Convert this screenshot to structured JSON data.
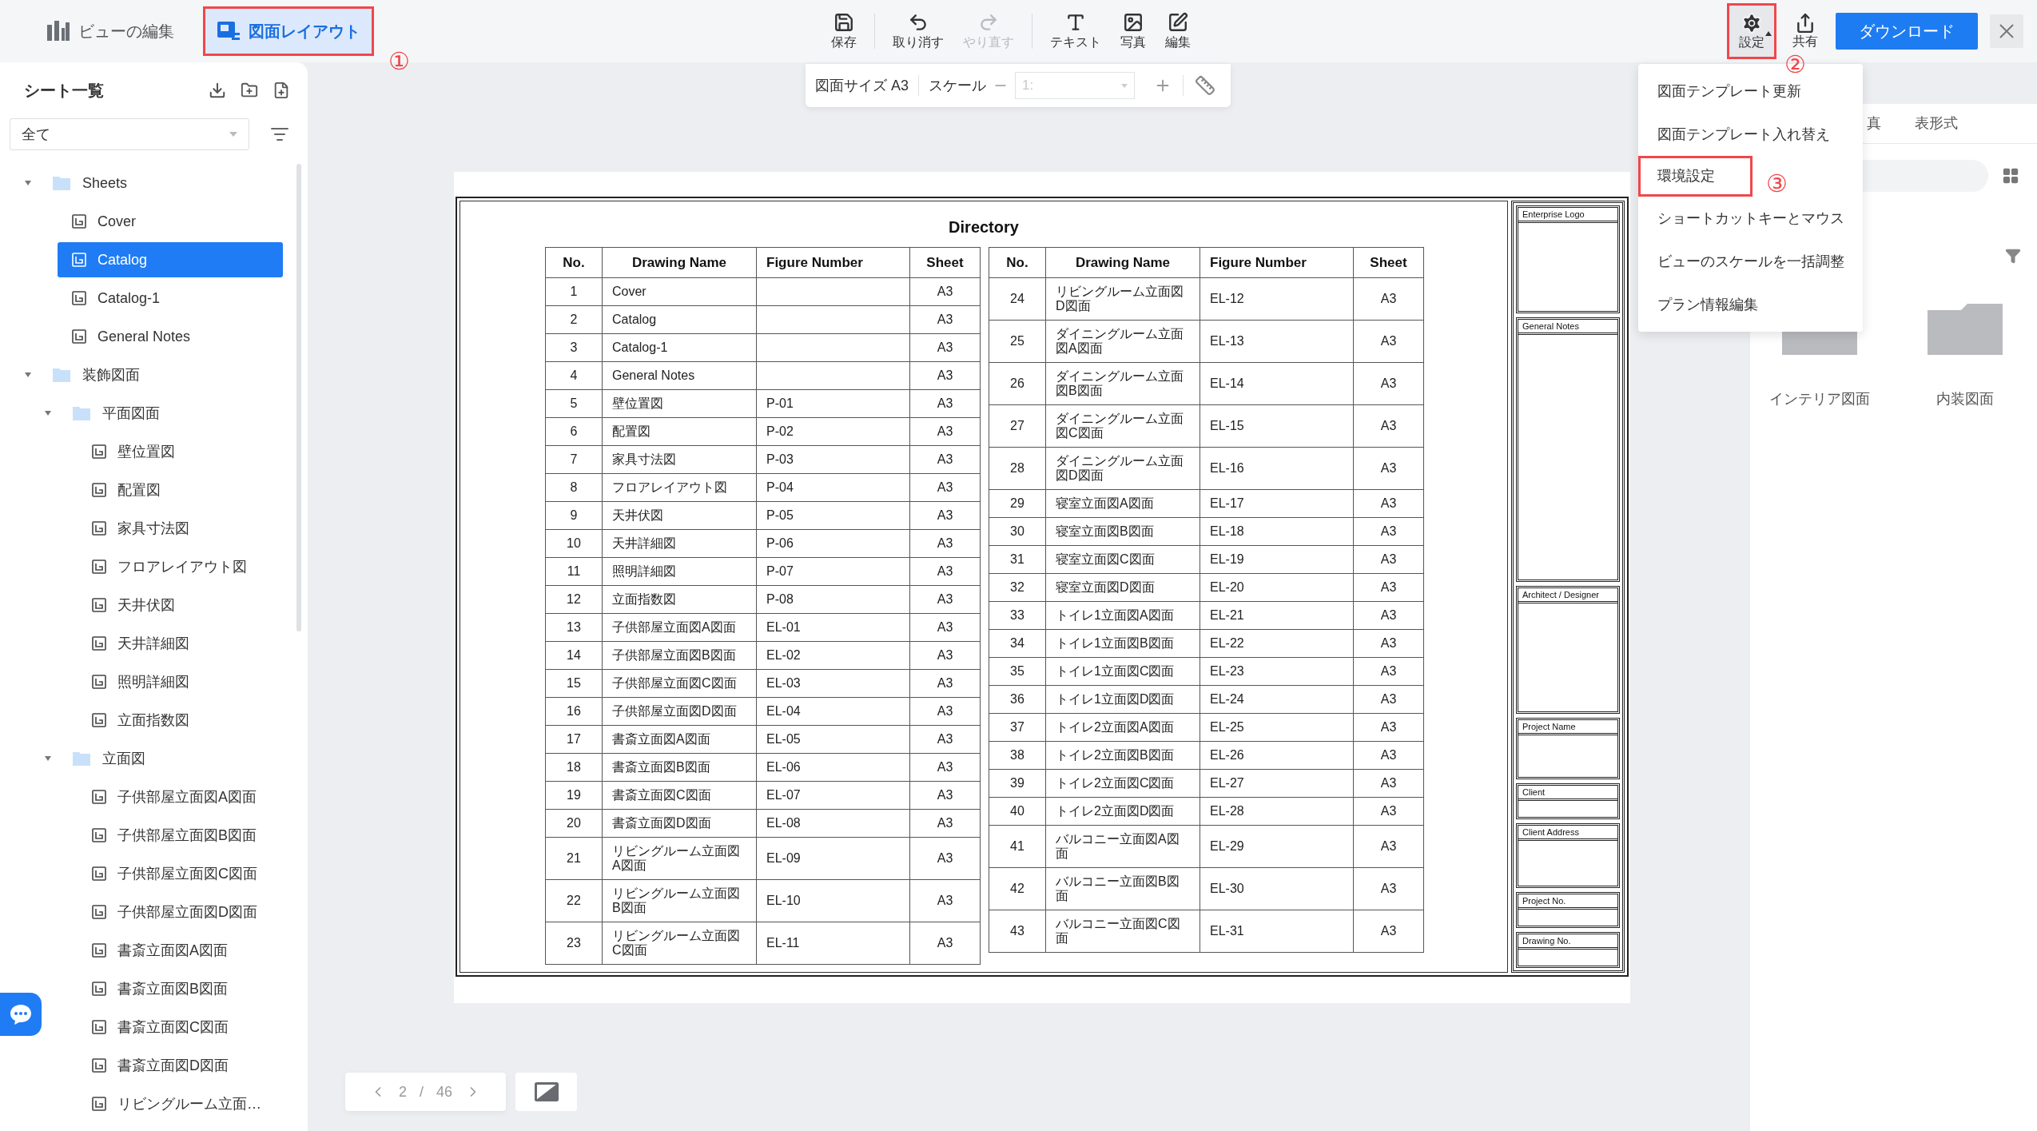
{
  "top_bar": {
    "mode_tabs": [
      {
        "label": "ビューの編集",
        "selected": false
      },
      {
        "label": "図面レイアウト",
        "selected": true,
        "callout": "①"
      }
    ],
    "tools": [
      {
        "kind": "save",
        "separator_after": true,
        "label": "保存",
        "disabled": false
      },
      {
        "kind": "undo",
        "separator_after": false,
        "label": "取り消す",
        "disabled": false
      },
      {
        "kind": "redo",
        "separator_after": true,
        "label": "やり直す",
        "disabled": true
      },
      {
        "kind": "text",
        "separator_after": false,
        "label": "テキスト",
        "disabled": false
      },
      {
        "kind": "photo",
        "separator_after": false,
        "label": "写真",
        "disabled": false
      },
      {
        "kind": "edit",
        "separator_after": false,
        "label": "編集",
        "disabled": false
      }
    ],
    "settings": {
      "label": "設定",
      "expanded": true,
      "callout": "②"
    },
    "share": {
      "label": "共有"
    },
    "download_button": "ダウンロード"
  },
  "settings_menu": [
    {
      "label": "図面テンプレート更新"
    },
    {
      "label": "図面テンプレート入れ替え"
    },
    {
      "label": "環境設定",
      "callout": "③"
    },
    {
      "label": "ショートカットキーとマウス"
    },
    {
      "label": "ビューのスケールを一括調整"
    },
    {
      "label": "プラン情報編集"
    }
  ],
  "sidebar": {
    "title": "シート一覧",
    "filter": {
      "value": "全て"
    },
    "tree": [
      {
        "kind": "folder",
        "label": "Sheets",
        "expanded": true,
        "selected": false,
        "children": [
          {
            "kind": "sheet",
            "label": "Cover",
            "selected": false
          },
          {
            "kind": "sheet",
            "label": "Catalog",
            "selected": true
          },
          {
            "kind": "sheet",
            "label": "Catalog-1",
            "selected": false
          },
          {
            "kind": "sheet",
            "label": "General Notes",
            "selected": false
          }
        ]
      },
      {
        "kind": "folder",
        "label": "装飾図面",
        "expanded": true,
        "selected": false,
        "children": [
          {
            "kind": "folder",
            "label": "平面図面",
            "expanded": true,
            "selected": false,
            "children": [
              {
                "kind": "sheet",
                "label": "壁位置図",
                "selected": false
              },
              {
                "kind": "sheet",
                "label": "配置図",
                "selected": false
              },
              {
                "kind": "sheet",
                "label": "家具寸法図",
                "selected": false
              },
              {
                "kind": "sheet",
                "label": "フロアレイアウト図",
                "selected": false
              },
              {
                "kind": "sheet",
                "label": "天井伏図",
                "selected": false
              },
              {
                "kind": "sheet",
                "label": "天井詳細図",
                "selected": false
              },
              {
                "kind": "sheet",
                "label": "照明詳細図",
                "selected": false
              },
              {
                "kind": "sheet",
                "label": "立面指数図",
                "selected": false
              }
            ]
          },
          {
            "kind": "folder",
            "label": "立面図",
            "expanded": true,
            "selected": false,
            "children": [
              {
                "kind": "sheet",
                "label": "子供部屋立面図A図面",
                "selected": false
              },
              {
                "kind": "sheet",
                "label": "子供部屋立面図B図面",
                "selected": false
              },
              {
                "kind": "sheet",
                "label": "子供部屋立面図C図面",
                "selected": false
              },
              {
                "kind": "sheet",
                "label": "子供部屋立面図D図面",
                "selected": false
              },
              {
                "kind": "sheet",
                "label": "書斎立面図A図面",
                "selected": false
              },
              {
                "kind": "sheet",
                "label": "書斎立面図B図面",
                "selected": false
              },
              {
                "kind": "sheet",
                "label": "書斎立面図C図面",
                "selected": false
              },
              {
                "kind": "sheet",
                "label": "書斎立面図D図面",
                "selected": false
              },
              {
                "kind": "sheet",
                "label": "リビングルーム立面…",
                "selected": false
              }
            ]
          }
        ]
      }
    ]
  },
  "scale_toolbar": {
    "size_label": "図面サイズ A3",
    "scale_label": "スケール",
    "scale_placeholder": "1:"
  },
  "sheet": {
    "title": "Directory",
    "tables": [
      {
        "columns": [
          "No.",
          "Drawing Name",
          "Figure Number",
          "Sheet"
        ],
        "rows": [
          {
            "no": "1",
            "name": "Cover",
            "sheet": "A3"
          },
          {
            "no": "2",
            "name": "Catalog",
            "sheet": "A3"
          },
          {
            "no": "3",
            "name": "Catalog-1",
            "sheet": "A3"
          },
          {
            "no": "4",
            "name": "General Notes",
            "sheet": "A3"
          },
          {
            "no": "5",
            "name": "壁位置図",
            "figure": "P-01",
            "sheet": "A3"
          },
          {
            "no": "6",
            "name": "配置図",
            "figure": "P-02",
            "sheet": "A3"
          },
          {
            "no": "7",
            "name": "家具寸法図",
            "figure": "P-03",
            "sheet": "A3"
          },
          {
            "no": "8",
            "name": "フロアレイアウト図",
            "figure": "P-04",
            "sheet": "A3"
          },
          {
            "no": "9",
            "name": "天井伏図",
            "figure": "P-05",
            "sheet": "A3"
          },
          {
            "no": "10",
            "name": "天井詳細図",
            "figure": "P-06",
            "sheet": "A3"
          },
          {
            "no": "11",
            "name": "照明詳細図",
            "figure": "P-07",
            "sheet": "A3"
          },
          {
            "no": "12",
            "name": "立面指数図",
            "figure": "P-08",
            "sheet": "A3"
          },
          {
            "no": "13",
            "name": "子供部屋立面図A図面",
            "figure": "EL-01",
            "sheet": "A3"
          },
          {
            "no": "14",
            "name": "子供部屋立面図B図面",
            "figure": "EL-02",
            "sheet": "A3"
          },
          {
            "no": "15",
            "name": "子供部屋立面図C図面",
            "figure": "EL-03",
            "sheet": "A3"
          },
          {
            "no": "16",
            "name": "子供部屋立面図D図面",
            "figure": "EL-04",
            "sheet": "A3"
          },
          {
            "no": "17",
            "name": "書斎立面図A図面",
            "figure": "EL-05",
            "sheet": "A3"
          },
          {
            "no": "18",
            "name": "書斎立面図B図面",
            "figure": "EL-06",
            "sheet": "A3"
          },
          {
            "no": "19",
            "name": "書斎立面図C図面",
            "figure": "EL-07",
            "sheet": "A3"
          },
          {
            "no": "20",
            "name": "書斎立面図D図面",
            "figure": "EL-08",
            "sheet": "A3"
          },
          {
            "no": "21",
            "name": "リビングルーム立面図A図面",
            "figure": "EL-09",
            "sheet": "A3"
          },
          {
            "no": "22",
            "name": "リビングルーム立面図B図面",
            "figure": "EL-10",
            "sheet": "A3"
          },
          {
            "no": "23",
            "name": "リビングルーム立面図C図面",
            "figure": "EL-11",
            "sheet": "A3"
          }
        ]
      },
      {
        "columns": [
          "No.",
          "Drawing Name",
          "Figure Number",
          "Sheet"
        ],
        "rows": [
          {
            "no": "24",
            "name": "リビングルーム立面図D図面",
            "figure": "EL-12",
            "sheet": "A3"
          },
          {
            "no": "25",
            "name": "ダイニングルーム立面図A図面",
            "figure": "EL-13",
            "sheet": "A3"
          },
          {
            "no": "26",
            "name": "ダイニングルーム立面図B図面",
            "figure": "EL-14",
            "sheet": "A3"
          },
          {
            "no": "27",
            "name": "ダイニングルーム立面図C図面",
            "figure": "EL-15",
            "sheet": "A3"
          },
          {
            "no": "28",
            "name": "ダイニングルーム立面図D図面",
            "figure": "EL-16",
            "sheet": "A3"
          },
          {
            "no": "29",
            "name": "寝室立面図A図面",
            "figure": "EL-17",
            "sheet": "A3"
          },
          {
            "no": "30",
            "name": "寝室立面図B図面",
            "figure": "EL-18",
            "sheet": "A3"
          },
          {
            "no": "31",
            "name": "寝室立面図C図面",
            "figure": "EL-19",
            "sheet": "A3"
          },
          {
            "no": "32",
            "name": "寝室立面図D図面",
            "figure": "EL-20",
            "sheet": "A3"
          },
          {
            "no": "33",
            "name": "トイレ1立面図A図面",
            "figure": "EL-21",
            "sheet": "A3"
          },
          {
            "no": "34",
            "name": "トイレ1立面図B図面",
            "figure": "EL-22",
            "sheet": "A3"
          },
          {
            "no": "35",
            "name": "トイレ1立面図C図面",
            "figure": "EL-23",
            "sheet": "A3"
          },
          {
            "no": "36",
            "name": "トイレ1立面図D図面",
            "figure": "EL-24",
            "sheet": "A3"
          },
          {
            "no": "37",
            "name": "トイレ2立面図A図面",
            "figure": "EL-25",
            "sheet": "A3"
          },
          {
            "no": "38",
            "name": "トイレ2立面図B図面",
            "figure": "EL-26",
            "sheet": "A3"
          },
          {
            "no": "39",
            "name": "トイレ2立面図C図面",
            "figure": "EL-27",
            "sheet": "A3"
          },
          {
            "no": "40",
            "name": "トイレ2立面図D図面",
            "figure": "EL-28",
            "sheet": "A3"
          },
          {
            "no": "41",
            "name": "バルコニー立面図A図面",
            "figure": "EL-29",
            "sheet": "A3"
          },
          {
            "no": "42",
            "name": "バルコニー立面図B図面",
            "figure": "EL-30",
            "sheet": "A3"
          },
          {
            "no": "43",
            "name": "バルコニー立面図C図面",
            "figure": "EL-31",
            "sheet": "A3"
          }
        ]
      }
    ],
    "title_block": [
      "Enterprise Logo",
      "General Notes",
      "Architect / Designer",
      "Project Name",
      "Client",
      "Client Address",
      "Project No.",
      "Drawing No."
    ]
  },
  "right_panel": {
    "tabs": [
      "真",
      "表形式"
    ],
    "folders": [
      "インテリア図面",
      "内装図面"
    ]
  },
  "pager": {
    "current": "2",
    "separator": "/",
    "total": "46"
  }
}
